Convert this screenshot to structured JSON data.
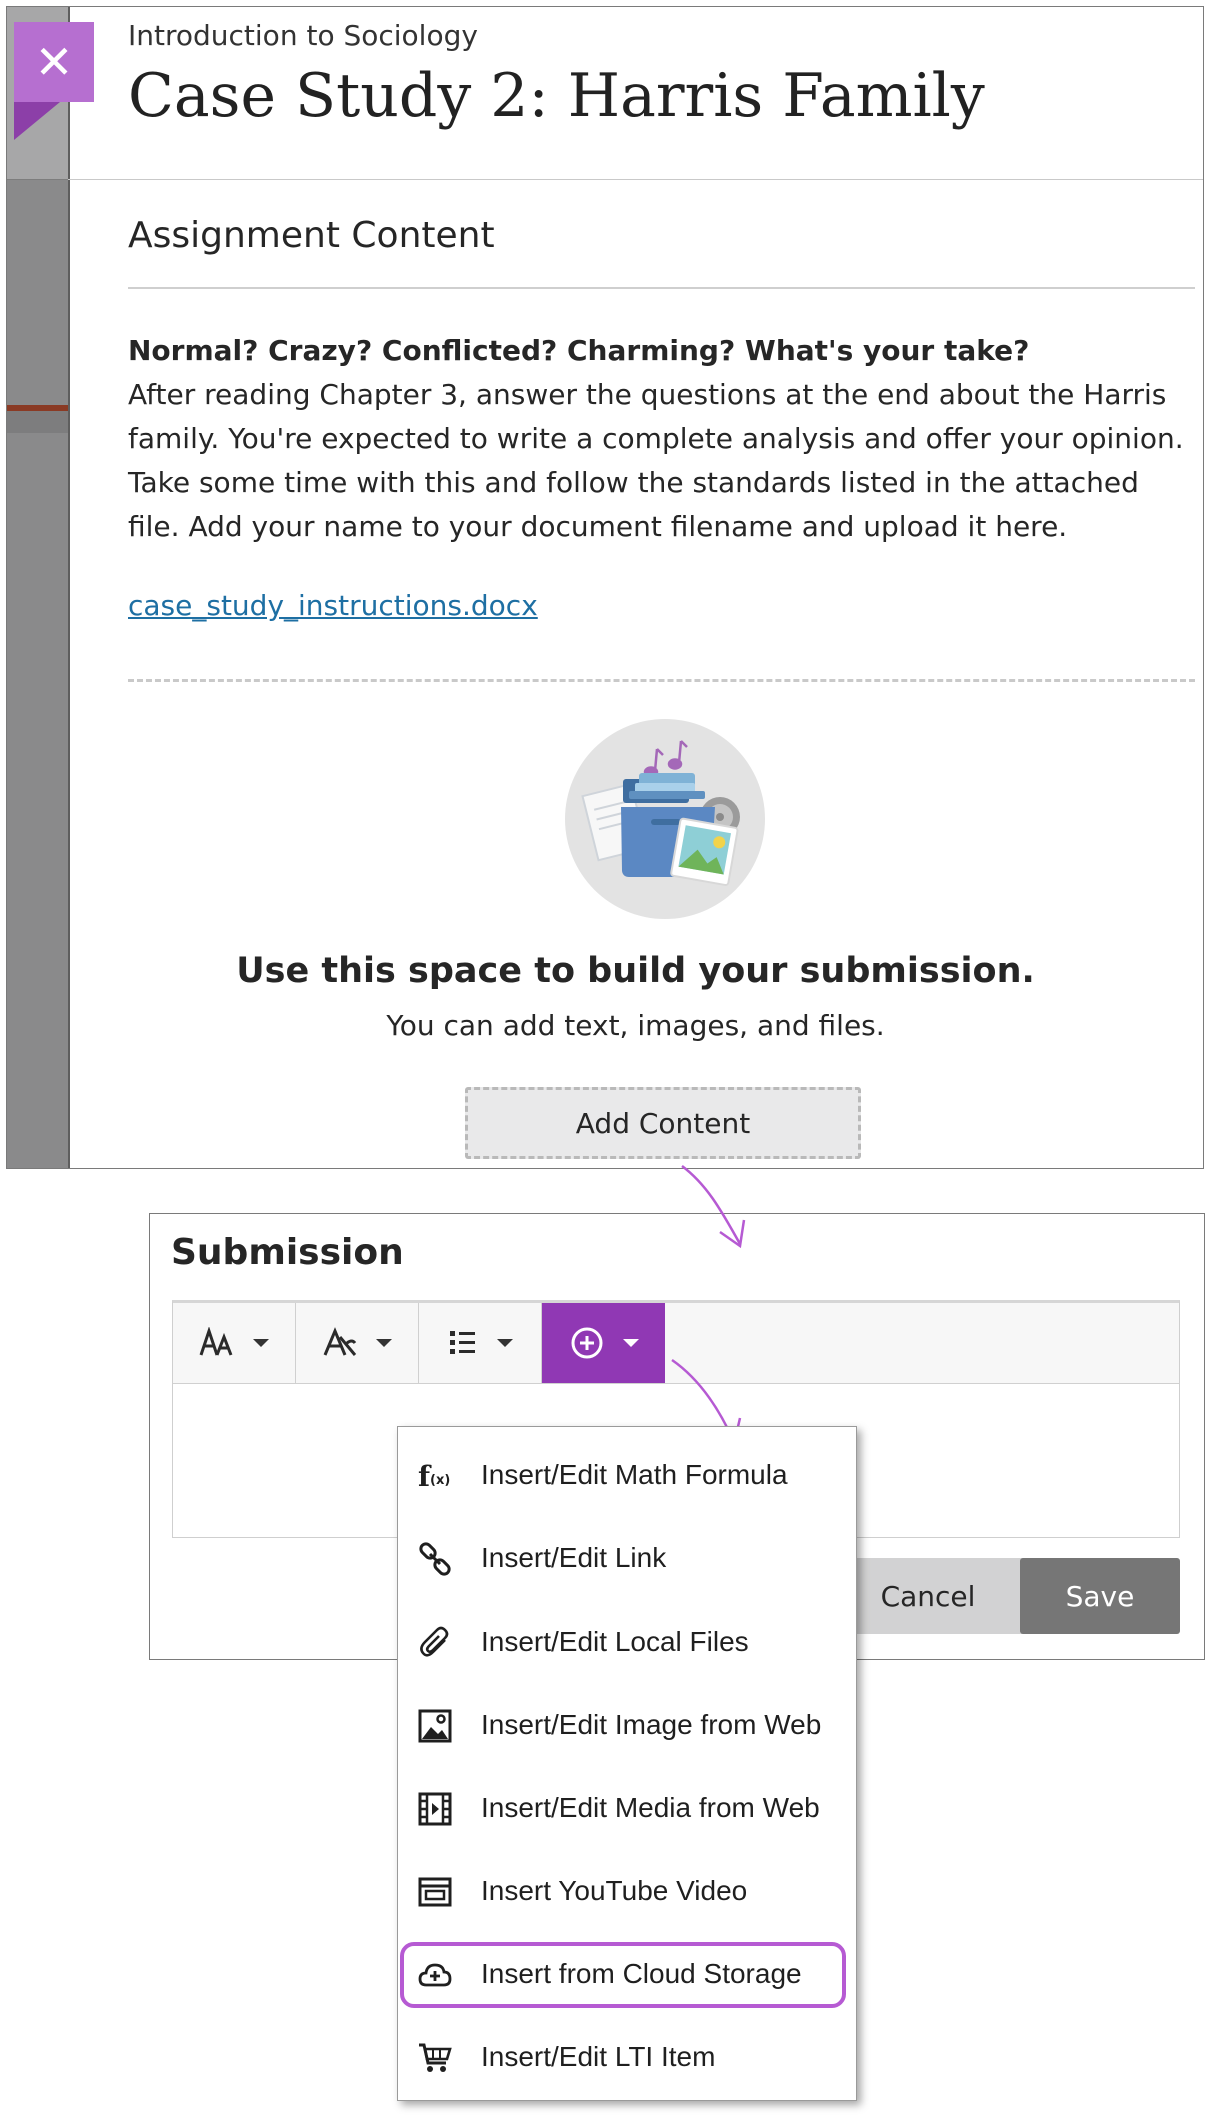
{
  "header": {
    "course_name": "Introduction to Sociology",
    "page_title": "Case Study 2: Harris Family",
    "close_label": "✕"
  },
  "assignment": {
    "section_title": "Assignment Content",
    "prompt_question": "Normal? Crazy? Conflicted? Charming? What's your take?",
    "prompt_body": "After reading Chapter 3, answer the questions at the end about the Harris family. You're expected to write a complete analysis and offer your opinion. Take some time with this and follow the standards listed in the attached file. Add your name to your document filename and upload it here.",
    "attachment": "case_study_instructions.docx"
  },
  "empty_state": {
    "icon": "files-folder-illustration",
    "title": "Use this space to build your submission.",
    "subtitle": "You can add text, images, and files.",
    "add_button": "Add Content"
  },
  "submission": {
    "title": "Submission",
    "toolbar": [
      {
        "icon": "font-size-icon",
        "has_dropdown": true
      },
      {
        "icon": "text-format-icon",
        "has_dropdown": true
      },
      {
        "icon": "list-icon",
        "has_dropdown": true
      },
      {
        "icon": "insert-plus-icon",
        "has_dropdown": true,
        "active": true
      }
    ],
    "cancel_label": "Cancel",
    "save_label": "Save"
  },
  "insert_menu": {
    "items": [
      {
        "label": "Insert/Edit Math Formula",
        "icon": "math-formula-icon"
      },
      {
        "label": "Insert/Edit Link",
        "icon": "link-icon"
      },
      {
        "label": "Insert/Edit Local Files",
        "icon": "paperclip-icon"
      },
      {
        "label": "Insert/Edit Image from Web",
        "icon": "image-icon"
      },
      {
        "label": "Insert/Edit Media from Web",
        "icon": "film-icon"
      },
      {
        "label": "Insert YouTube Video",
        "icon": "video-embed-icon"
      },
      {
        "label": "Insert from Cloud Storage",
        "icon": "cloud-upload-icon",
        "highlighted": true
      },
      {
        "label": "Insert/Edit LTI Item",
        "icon": "cart-icon"
      }
    ]
  },
  "colors": {
    "accent_purple": "#9038b4",
    "close_tab": "#b66fd0",
    "callout_outline": "#b65ad3",
    "link_blue": "#1e6fa3"
  }
}
